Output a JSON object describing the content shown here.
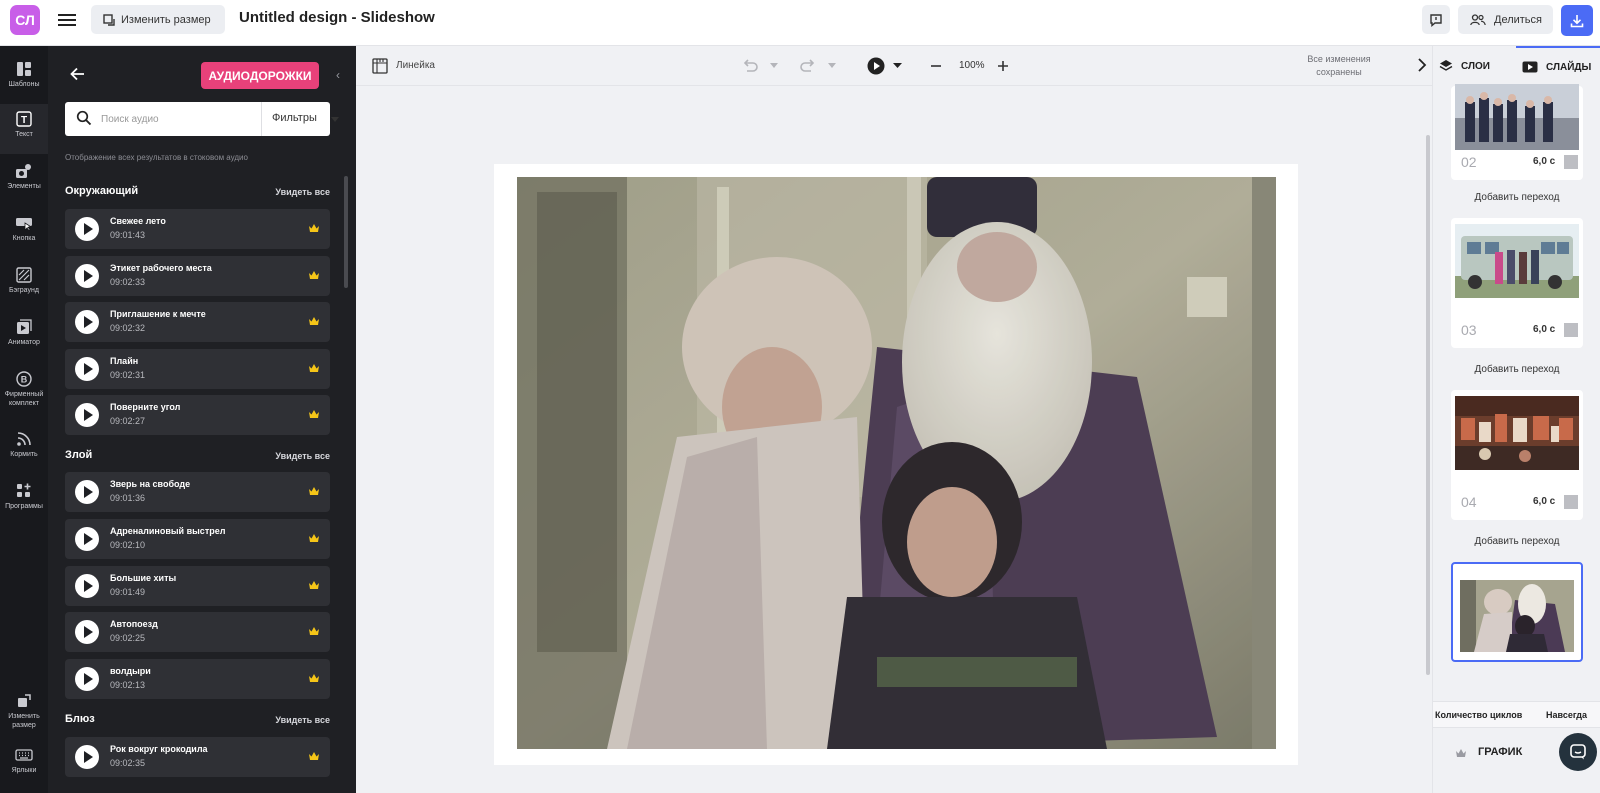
{
  "topbar": {
    "logo": "СЛ",
    "resize_label": "Изменить размер",
    "title": "Untitled design - Slideshow",
    "share_label": "Делиться"
  },
  "rail": {
    "items": [
      {
        "label": "Шаблоны",
        "icon": "templates-icon"
      },
      {
        "label": "Текст",
        "icon": "text-icon"
      },
      {
        "label": "Элементы",
        "icon": "elements-icon"
      },
      {
        "label": "Кнопка",
        "icon": "button-icon"
      },
      {
        "label": "Бэграунд",
        "icon": "background-icon"
      },
      {
        "label": "Аниматор",
        "icon": "animator-icon"
      },
      {
        "label": "Фирменный комплект",
        "icon": "brand-kit-icon"
      },
      {
        "label": "Кормить",
        "icon": "feed-icon"
      },
      {
        "label": "Программы",
        "icon": "apps-icon"
      },
      {
        "label": "Изменить размер",
        "icon": "resize-icon"
      },
      {
        "label": "Ярлыки",
        "icon": "keyboard-icon"
      }
    ]
  },
  "panel": {
    "title": "АУДИОДОРОЖКИ",
    "search_placeholder": "Поиск аудио",
    "filters_label": "Фильтры",
    "hint": "Отображение всех результатов в стоковом аудио",
    "see_all": "Увидеть все",
    "categories": [
      {
        "name": "Окружающий",
        "tracks": [
          {
            "title": "Свежее лето",
            "duration": "09:01:43"
          },
          {
            "title": "Этикет рабочего места",
            "duration": "09:02:33"
          },
          {
            "title": "Приглашение к мечте",
            "duration": "09:02:32"
          },
          {
            "title": "Плайн",
            "duration": "09:02:31"
          },
          {
            "title": "Поверните угол",
            "duration": "09:02:27"
          }
        ]
      },
      {
        "name": "Злой",
        "tracks": [
          {
            "title": "Зверь на свободе",
            "duration": "09:01:36"
          },
          {
            "title": "Адреналиновый выстрел",
            "duration": "09:02:10"
          },
          {
            "title": "Большие хиты",
            "duration": "09:01:49"
          },
          {
            "title": "Автопоезд",
            "duration": "09:02:25"
          },
          {
            "title": "волдыри",
            "duration": "09:02:13"
          }
        ]
      },
      {
        "name": "Блюз",
        "tracks": [
          {
            "title": "Рок вокруг крокодила",
            "duration": "09:02:35"
          }
        ]
      }
    ]
  },
  "toolbar": {
    "ruler_label": "Линейка",
    "zoom": "100%",
    "saved_line1": "Все изменения",
    "saved_line2": "сохранены"
  },
  "right_panel": {
    "tab_layers": "СЛОИ",
    "tab_slides": "СЛАЙДЫ",
    "slides": [
      {
        "num": "02",
        "duration": "6,0 с"
      },
      {
        "num": "03",
        "duration": "6,0 с"
      },
      {
        "num": "04",
        "duration": "6,0 с"
      }
    ],
    "add_transition": "Добавить переход",
    "cycles_label": "Количество циклов",
    "cycles_value": "Навсегда",
    "graph_label": "ГРАФИК"
  },
  "colors": {
    "accent_blue": "#4b6bf5",
    "chip_pink": "#e8417a",
    "logo_purple": "#c85ee8",
    "panel_dark": "#1f2024"
  }
}
